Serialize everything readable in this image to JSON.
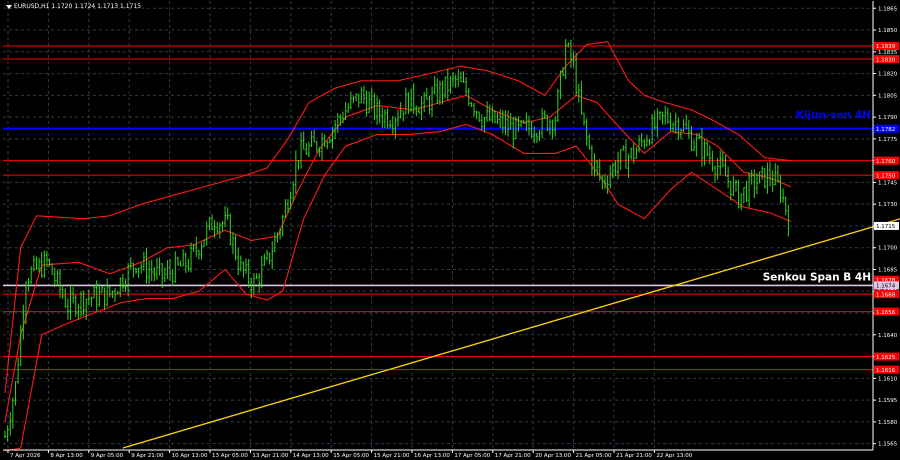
{
  "header": {
    "symbol_info": "EURUSD,H1  1.1720 1.1724 1.1713 1.1715"
  },
  "chart_data": {
    "type": "line",
    "instrument": "EURUSD,H1",
    "ohlc": {
      "open": 1.172,
      "high": 1.1724,
      "low": 1.1713,
      "close": 1.1715
    },
    "x_tick_labels": [
      "7 Apr 2026",
      "8 Apr 13:00",
      "9 Apr 05:00",
      "9 Apr 21:00",
      "10 Apr 13:00",
      "13 Apr 05:00",
      "13 Apr 21:00",
      "14 Apr 13:00",
      "15 Apr 05:00",
      "15 Apr 21:00",
      "16 Apr 13:00",
      "17 Apr 05:00",
      "17 Apr 21:00",
      "20 Apr 13:00",
      "21 Apr 05:00",
      "21 Apr 21:00",
      "22 Apr 13:00"
    ],
    "y_tick_values": [
      "1.1865",
      "1.1850",
      "1.1835",
      "1.1820",
      "1.1805",
      "1.1790",
      "1.1775",
      "1.1760",
      "1.1745",
      "1.1730",
      "1.1715",
      "1.1700",
      "1.1685",
      "1.1670",
      "1.1655",
      "1.1640",
      "1.1625",
      "1.1610",
      "1.1595",
      "1.1580",
      "1.1565"
    ],
    "ylim": [
      1.1562,
      1.187
    ],
    "grid": true,
    "horizontal_levels": [
      {
        "value": 1.1839,
        "label": "1.1839",
        "color": "#ff0000"
      },
      {
        "value": 1.183,
        "label": "1.1830",
        "color": "#ff0000"
      },
      {
        "value": 1.176,
        "label": "1.1760",
        "color": "#ff0000"
      },
      {
        "value": 1.175,
        "label": "1.1750",
        "color": "#ff0000"
      },
      {
        "value": 1.1668,
        "label": "1.1668",
        "color": "#ff0000"
      },
      {
        "value": 1.1656,
        "label": "1.1656",
        "color": "#ff0000"
      },
      {
        "value": 1.1625,
        "label": "1.1625",
        "color": "#ff0000"
      },
      {
        "value": 1.1616,
        "label": "1.1616",
        "color": "#ff0000"
      }
    ],
    "kijun_sen": {
      "value": 1.1782,
      "label": "Kijun-sen 4H",
      "price_label": "1.1782",
      "color": "#0000ff"
    },
    "senkou_span_b": {
      "value": 1.1674,
      "label": "Senkou Span B 4H",
      "price_label": "1.1674",
      "color": "#dcc8e6"
    },
    "extra_price_labels": [
      {
        "value": 1.1678,
        "label": "1.1678",
        "color": "#ff0000"
      },
      {
        "value": 1.1715,
        "label": "1.1715",
        "color": "#ffffff"
      }
    ],
    "trendline": {
      "from": {
        "bar": 45,
        "price": 1.1562
      },
      "to": {
        "bar": 355,
        "price": 1.1727
      },
      "color": "#ffd400"
    },
    "price_series": {
      "color": "#2fd41e",
      "bars": 300,
      "anchors": [
        [
          0,
          1.157
        ],
        [
          4,
          1.1605
        ],
        [
          8,
          1.168
        ],
        [
          16,
          1.169
        ],
        [
          24,
          1.166
        ],
        [
          30,
          1.1665
        ],
        [
          40,
          1.1668
        ],
        [
          50,
          1.169
        ],
        [
          60,
          1.168
        ],
        [
          70,
          1.169
        ],
        [
          80,
          1.172
        ],
        [
          85,
          1.1715
        ],
        [
          90,
          1.1685
        ],
        [
          95,
          1.1675
        ],
        [
          100,
          1.169
        ],
        [
          106,
          1.172
        ],
        [
          112,
          1.1765
        ],
        [
          118,
          1.177
        ],
        [
          124,
          1.178
        ],
        [
          130,
          1.1795
        ],
        [
          136,
          1.1805
        ],
        [
          142,
          1.1793
        ],
        [
          148,
          1.179
        ],
        [
          154,
          1.1802
        ],
        [
          160,
          1.1798
        ],
        [
          166,
          1.1808
        ],
        [
          172,
          1.1815
        ],
        [
          176,
          1.1808
        ],
        [
          182,
          1.179
        ],
        [
          190,
          1.1785
        ],
        [
          196,
          1.178
        ],
        [
          204,
          1.1785
        ],
        [
          210,
          1.179
        ],
        [
          214,
          1.1838
        ],
        [
          217,
          1.1825
        ],
        [
          220,
          1.179
        ],
        [
          224,
          1.176
        ],
        [
          228,
          1.1745
        ],
        [
          234,
          1.176
        ],
        [
          240,
          1.1765
        ],
        [
          246,
          1.178
        ],
        [
          252,
          1.179
        ],
        [
          258,
          1.1785
        ],
        [
          262,
          1.1775
        ],
        [
          268,
          1.1765
        ],
        [
          274,
          1.1752
        ],
        [
          280,
          1.1735
        ],
        [
          286,
          1.1745
        ],
        [
          292,
          1.175
        ],
        [
          296,
          1.174
        ],
        [
          300,
          1.1715
        ]
      ]
    },
    "bands": {
      "color": "#ff1a1a",
      "upper": [
        [
          0,
          1.16
        ],
        [
          6,
          1.17
        ],
        [
          12,
          1.1722
        ],
        [
          30,
          1.172
        ],
        [
          40,
          1.1722
        ],
        [
          52,
          1.173
        ],
        [
          62,
          1.1735
        ],
        [
          72,
          1.174
        ],
        [
          82,
          1.1745
        ],
        [
          92,
          1.175
        ],
        [
          100,
          1.1755
        ],
        [
          108,
          1.1775
        ],
        [
          116,
          1.18
        ],
        [
          126,
          1.181
        ],
        [
          136,
          1.1815
        ],
        [
          150,
          1.1815
        ],
        [
          162,
          1.182
        ],
        [
          174,
          1.1825
        ],
        [
          184,
          1.1822
        ],
        [
          196,
          1.1815
        ],
        [
          206,
          1.1805
        ],
        [
          214,
          1.1825
        ],
        [
          222,
          1.184
        ],
        [
          230,
          1.1842
        ],
        [
          238,
          1.1815
        ],
        [
          244,
          1.1805
        ],
        [
          252,
          1.18
        ],
        [
          262,
          1.1795
        ],
        [
          270,
          1.1788
        ],
        [
          280,
          1.1778
        ],
        [
          290,
          1.1762
        ],
        [
          300,
          1.176
        ]
      ],
      "middle": [
        [
          0,
          1.158
        ],
        [
          6,
          1.164
        ],
        [
          14,
          1.1688
        ],
        [
          28,
          1.169
        ],
        [
          40,
          1.1682
        ],
        [
          52,
          1.169
        ],
        [
          62,
          1.17
        ],
        [
          72,
          1.1702
        ],
        [
          84,
          1.1712
        ],
        [
          94,
          1.1705
        ],
        [
          104,
          1.1708
        ],
        [
          112,
          1.174
        ],
        [
          120,
          1.1768
        ],
        [
          130,
          1.179
        ],
        [
          142,
          1.1798
        ],
        [
          156,
          1.1795
        ],
        [
          166,
          1.18
        ],
        [
          176,
          1.1805
        ],
        [
          186,
          1.1795
        ],
        [
          198,
          1.1786
        ],
        [
          208,
          1.179
        ],
        [
          218,
          1.1805
        ],
        [
          226,
          1.18
        ],
        [
          236,
          1.178
        ],
        [
          244,
          1.1765
        ],
        [
          254,
          1.178
        ],
        [
          264,
          1.1778
        ],
        [
          272,
          1.177
        ],
        [
          282,
          1.1752
        ],
        [
          292,
          1.1748
        ],
        [
          300,
          1.1742
        ]
      ],
      "lower": [
        [
          0,
          1.156
        ],
        [
          6,
          1.1562
        ],
        [
          14,
          1.164
        ],
        [
          24,
          1.1648
        ],
        [
          34,
          1.1655
        ],
        [
          44,
          1.1662
        ],
        [
          54,
          1.1665
        ],
        [
          64,
          1.1665
        ],
        [
          74,
          1.167
        ],
        [
          84,
          1.1685
        ],
        [
          92,
          1.1668
        ],
        [
          100,
          1.1664
        ],
        [
          106,
          1.167
        ],
        [
          114,
          1.172
        ],
        [
          122,
          1.175
        ],
        [
          130,
          1.177
        ],
        [
          142,
          1.1778
        ],
        [
          154,
          1.1778
        ],
        [
          166,
          1.178
        ],
        [
          176,
          1.1785
        ],
        [
          186,
          1.1778
        ],
        [
          198,
          1.1765
        ],
        [
          210,
          1.1765
        ],
        [
          218,
          1.177
        ],
        [
          226,
          1.1752
        ],
        [
          234,
          1.173
        ],
        [
          244,
          1.172
        ],
        [
          254,
          1.174
        ],
        [
          262,
          1.1752
        ],
        [
          272,
          1.174
        ],
        [
          282,
          1.1728
        ],
        [
          292,
          1.1724
        ],
        [
          300,
          1.1718
        ]
      ]
    }
  }
}
